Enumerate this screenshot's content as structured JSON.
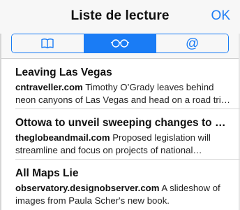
{
  "header": {
    "title": "Liste de lecture",
    "ok_label": "OK"
  },
  "segments": [
    {
      "icon": "book-icon",
      "active": false
    },
    {
      "icon": "glasses-icon",
      "active": true
    },
    {
      "icon": "at-icon",
      "glyph": "@",
      "active": false
    }
  ],
  "items": [
    {
      "title": "Leaving Las Vegas",
      "domain": "cntraveller.com",
      "text": " Timothy O’Grady leaves behind neon canyons of Las Vegas and head on a road trip to New Mexico"
    },
    {
      "title": "Ottowa to unveil sweeping changes to environmental laws",
      "domain": "theglobeandmail.com",
      "text": " Proposed legislation will streamline and focus on projects of national economic importance"
    },
    {
      "title": "All Maps Lie",
      "domain": "observatory.designobserver.com",
      "text": " A slideshow of images from Paula Scher's new book."
    }
  ],
  "colors": {
    "accent": "#1a7cf5",
    "header_bg": "#f7f7f7"
  }
}
